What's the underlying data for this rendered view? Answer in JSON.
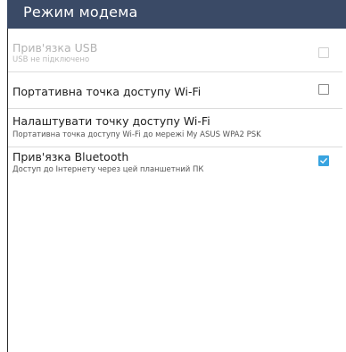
{
  "header": {
    "title": "Режим модема",
    "background": "#3a4a66"
  },
  "settings": [
    {
      "title": "Прив'язка USB",
      "summary": "USB не підключено",
      "enabled": false,
      "checked": false
    },
    {
      "title": "Портативна точка доступу Wi-Fi",
      "enabled": true,
      "checked": false
    },
    {
      "title": "Налаштувати точку доступу Wi-Fi",
      "summary": "Портативна точка доступу Wi-Fi до мережі My ASUS WPA2 PSK",
      "enabled": true
    },
    {
      "title": "Прив'язка Bluetooth",
      "summary": "Доступ до Інтернету через цей планшетний ПК",
      "enabled": true,
      "checked": true
    }
  ],
  "colors": {
    "accent": "#39a4e0",
    "text_primary": "#1e1e1e",
    "text_disabled": "#b3b3b3"
  }
}
